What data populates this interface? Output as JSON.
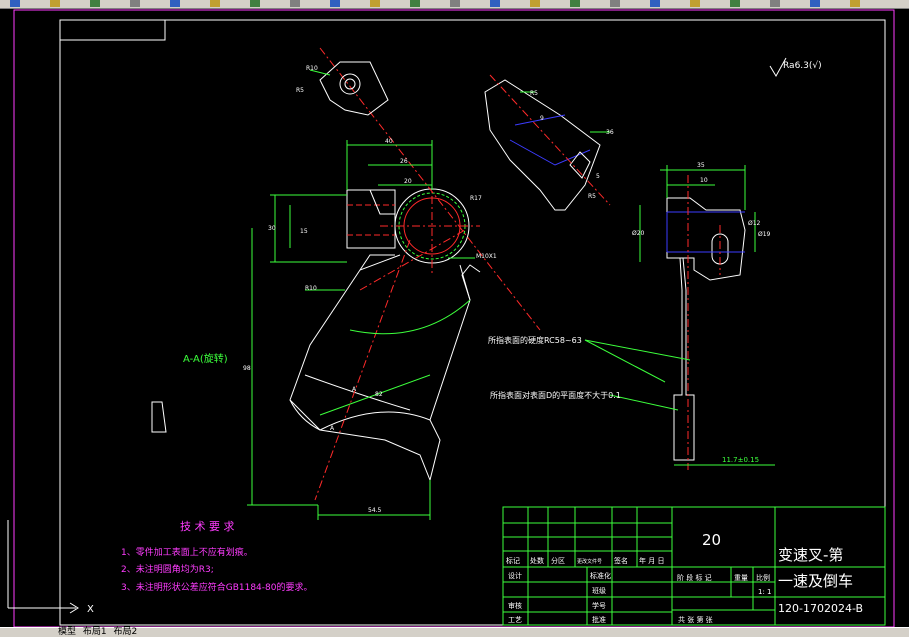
{
  "toolbar": {
    "icons": [
      "new-icon",
      "open-icon",
      "save-icon",
      "print-icon",
      "preview-icon",
      "cut-icon",
      "copy-icon",
      "paste-icon",
      "match-icon",
      "undo-icon",
      "redo-icon",
      "pan-icon",
      "zoom-icon",
      "zoom-window-icon",
      "zoom-prev-icon",
      "properties-icon",
      "designcenter-icon",
      "toolpalette-icon",
      "sheetset-icon",
      "markup-icon",
      "calc-icon",
      "help-icon"
    ]
  },
  "labels": {
    "r10_top": "R10",
    "r5_top": "R5",
    "r5_side": "R5",
    "r5_low": "R5",
    "dim_40": "40",
    "dim_26": "26",
    "dim_20": "20",
    "dim_r17": "R17",
    "dim_30": "30",
    "dim_15": "15",
    "dim_m10": "M10X1",
    "dim_r10_mid": "R10",
    "dim_36": "36",
    "dim_9": "9",
    "dim_5": "5",
    "dim_35": "35",
    "dim_10": "10",
    "dim_d20": "Ø20",
    "dim_d12": "Ø12",
    "dim_d19": "Ø19",
    "section": "A-A(旋转)",
    "dim_v98": "98",
    "dim_545": "54.5",
    "dim_82": "82",
    "dim_a": "A",
    "dim_a2": "A",
    "dim_117": "11.7±0.15",
    "note_hard": "所指表面的硬度RC58~63",
    "note_flat": "所指表面对表面D的平面度不大于0.1",
    "roughness": "Ra6.3(√)"
  },
  "tech": {
    "title": "技 术 要 求",
    "req1": "1、零件加工表面上不应有划痕。",
    "req2": "2、未注明圆角均为R3;",
    "req3": "3、未注明形状公差应符合GB1184-80的要求。"
  },
  "titleblock": {
    "number": "20",
    "name_line1": "变速叉-第",
    "name_line2": "一速及倒车",
    "code": "120-1702024-B",
    "scale": "1: 1",
    "h_mark": "标记",
    "h_count": "处数",
    "h_zone": "分区",
    "h_doc": "更改文件号",
    "h_sign": "签名",
    "h_date": "年 月 日",
    "r_design": "设计",
    "r_std": "标准化",
    "r_review": "审核",
    "r_craft": "工艺",
    "r_approve": "批准",
    "c_stage": "阶 段 标 记",
    "c_weight": "重量",
    "c_scale": "比例",
    "c_total": "共   张  第   张",
    "c_class": "班级",
    "c_id": "学号"
  },
  "status": {
    "model_tab": "模型",
    "layout1": "布局1",
    "layout2": "布局2"
  },
  "colors": {
    "bg": "#000000",
    "white": "#ffffff",
    "red": "#ff2a2a",
    "green": "#3cff3c",
    "blue": "#3c3cff",
    "magenta": "#ff3cff",
    "frame": "#ff3cff"
  }
}
